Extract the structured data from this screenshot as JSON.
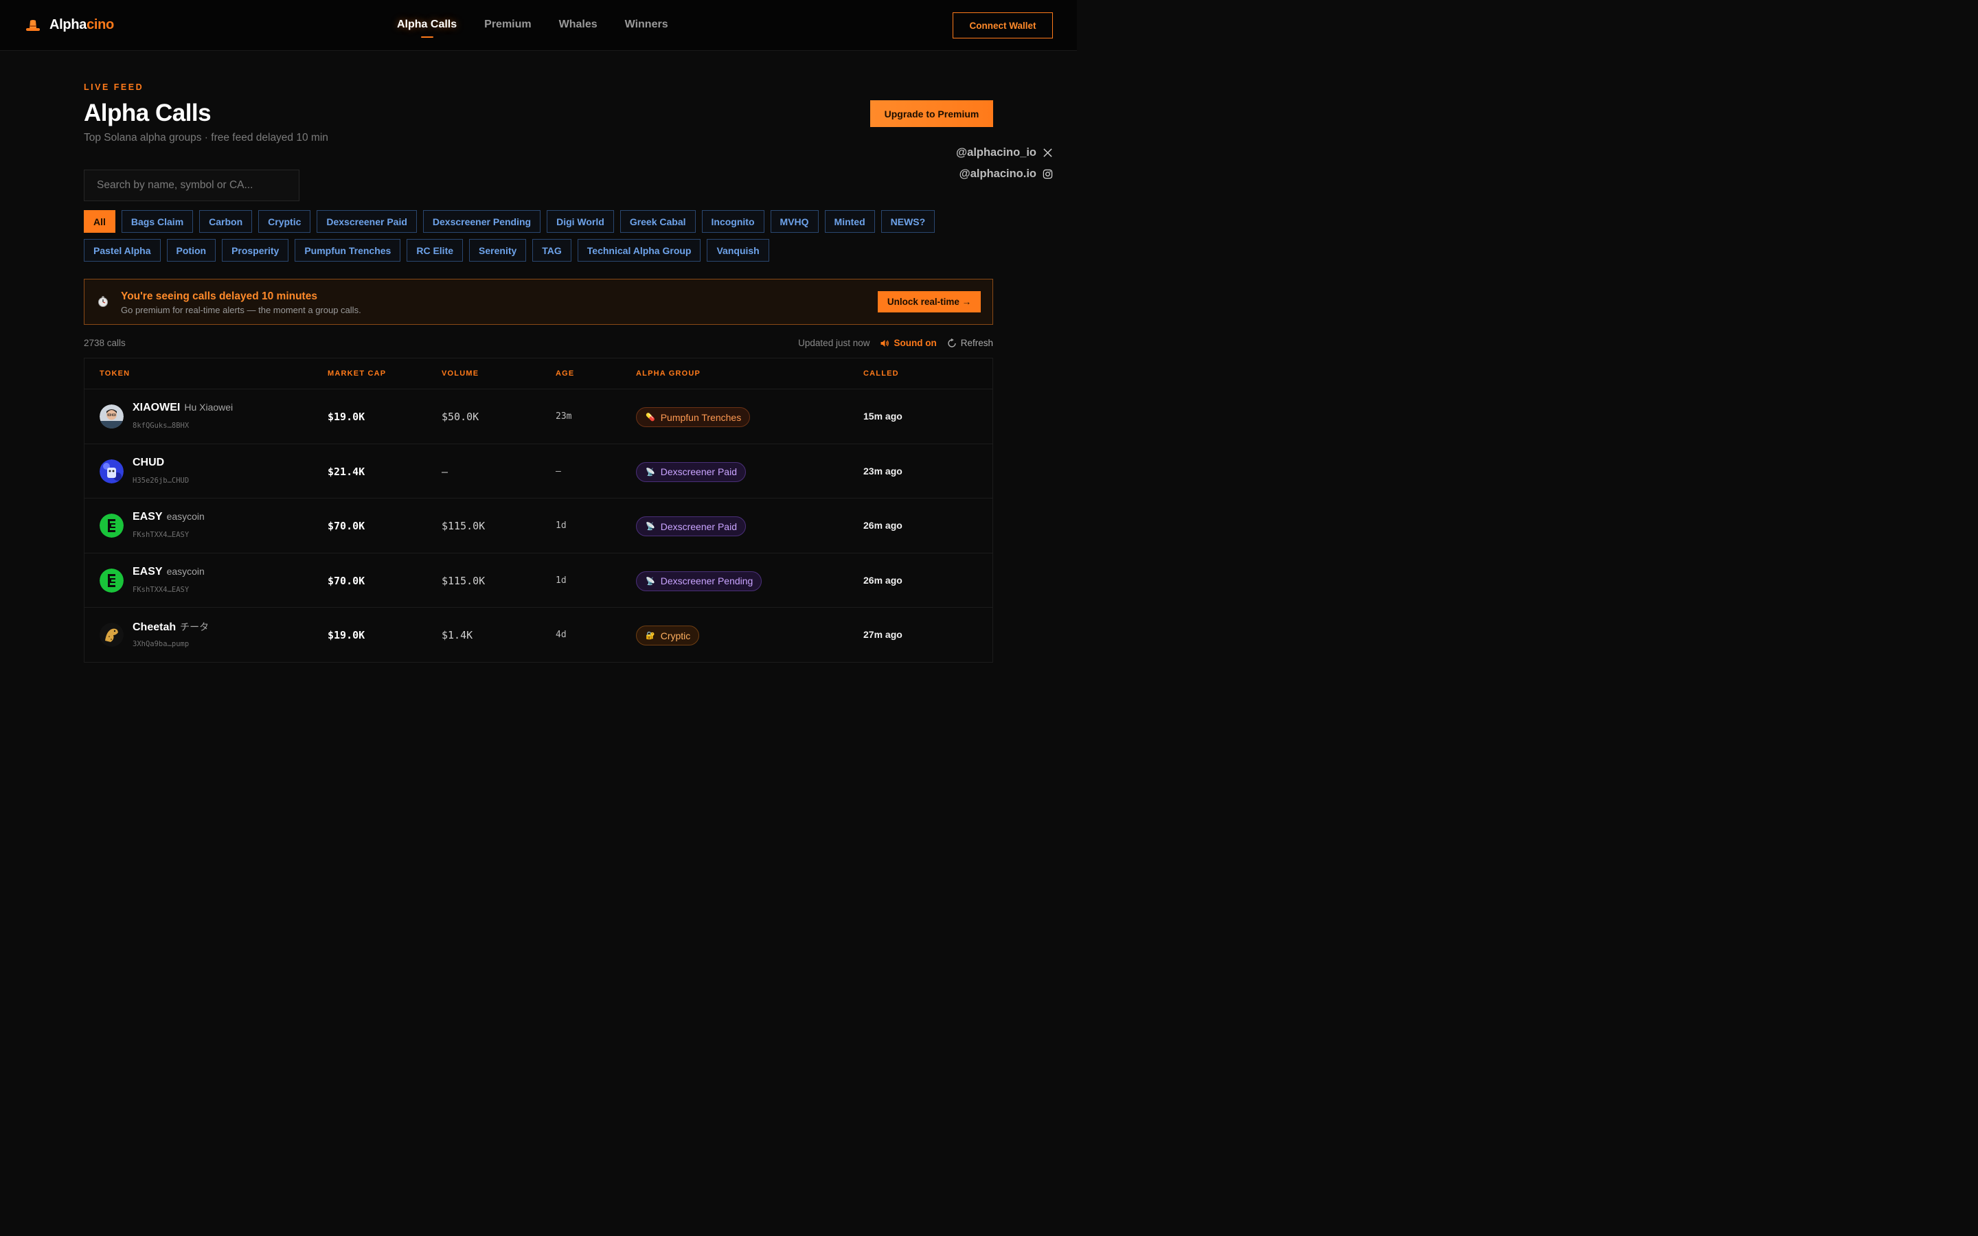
{
  "brand": {
    "name_part1": "Alpha",
    "name_part2": "cino"
  },
  "nav": [
    {
      "label": "Alpha Calls",
      "active": true
    },
    {
      "label": "Premium"
    },
    {
      "label": "Whales"
    },
    {
      "label": "Winners"
    }
  ],
  "connect_wallet": "Connect Wallet",
  "header": {
    "eyebrow": "LIVE FEED",
    "title": "Alpha Calls",
    "subtitle": "Top Solana alpha groups · free feed delayed 10 min",
    "upgrade_button": "Upgrade to Premium"
  },
  "social": {
    "x_handle": "@alphacino_io",
    "instagram_handle": "@alphacino.io"
  },
  "search": {
    "placeholder": "Search by name, symbol or CA..."
  },
  "filters": [
    "All",
    "Bags Claim",
    "Carbon",
    "Cryptic",
    "Dexscreener Paid",
    "Dexscreener Pending",
    "Digi World",
    "Greek Cabal",
    "Incognito",
    "MVHQ",
    "Minted",
    "NEWS?",
    "Pastel Alpha",
    "Potion",
    "Prosperity",
    "Pumpfun Trenches",
    "RC Elite",
    "Serenity",
    "TAG",
    "Technical Alpha Group",
    "Vanquish"
  ],
  "active_filter": "All",
  "banner": {
    "title": "You're seeing calls delayed 10 minutes",
    "subtitle": "Go premium for real-time alerts — the moment a group calls.",
    "button": "Unlock real-time →"
  },
  "status": {
    "count": "2738 calls",
    "updated": "Updated just now",
    "sound": "Sound on",
    "refresh": "Refresh"
  },
  "table": {
    "headers": {
      "token": "TOKEN",
      "market_cap": "MARKET CAP",
      "volume": "VOLUME",
      "age": "AGE",
      "group": "ALPHA GROUP",
      "called": "CALLED"
    },
    "rows": [
      {
        "symbol": "XIAOWEI",
        "name": "Hu Xiaowei",
        "address": "8kfQGuks…8BHX",
        "market_cap": "$19.0K",
        "volume": "$50.0K",
        "age": "23m",
        "group": "Pumpfun Trenches",
        "group_style": "orange",
        "group_icon": "💊",
        "called": "15m ago",
        "avatar": "xiaowei"
      },
      {
        "symbol": "CHUD",
        "name": "",
        "address": "H35e26jb…CHUD",
        "market_cap": "$21.4K",
        "volume": "—",
        "age": "—",
        "group": "Dexscreener Paid",
        "group_style": "purple",
        "group_icon": "📡",
        "called": "23m ago",
        "avatar": "chud"
      },
      {
        "symbol": "EASY",
        "name": "easycoin",
        "address": "FKshTXX4…EASY",
        "market_cap": "$70.0K",
        "volume": "$115.0K",
        "age": "1d",
        "group": "Dexscreener Paid",
        "group_style": "purple",
        "group_icon": "📡",
        "called": "26m ago",
        "avatar": "easy"
      },
      {
        "symbol": "EASY",
        "name": "easycoin",
        "address": "FKshTXX4…EASY",
        "market_cap": "$70.0K",
        "volume": "$115.0K",
        "age": "1d",
        "group": "Dexscreener Pending",
        "group_style": "purple",
        "group_icon": "📡",
        "called": "26m ago",
        "avatar": "easy"
      },
      {
        "symbol": "Cheetah",
        "name": "チータ",
        "address": "3XhQa9ba…pump",
        "market_cap": "$19.0K",
        "volume": "$1.4K",
        "age": "4d",
        "group": "Cryptic",
        "group_style": "gold",
        "group_icon": "🔐",
        "called": "27m ago",
        "avatar": "cheetah"
      }
    ]
  },
  "colors": {
    "accent": "#ff7a1a",
    "chip_text": "#6ea3ea",
    "background": "#0b0b0b"
  }
}
